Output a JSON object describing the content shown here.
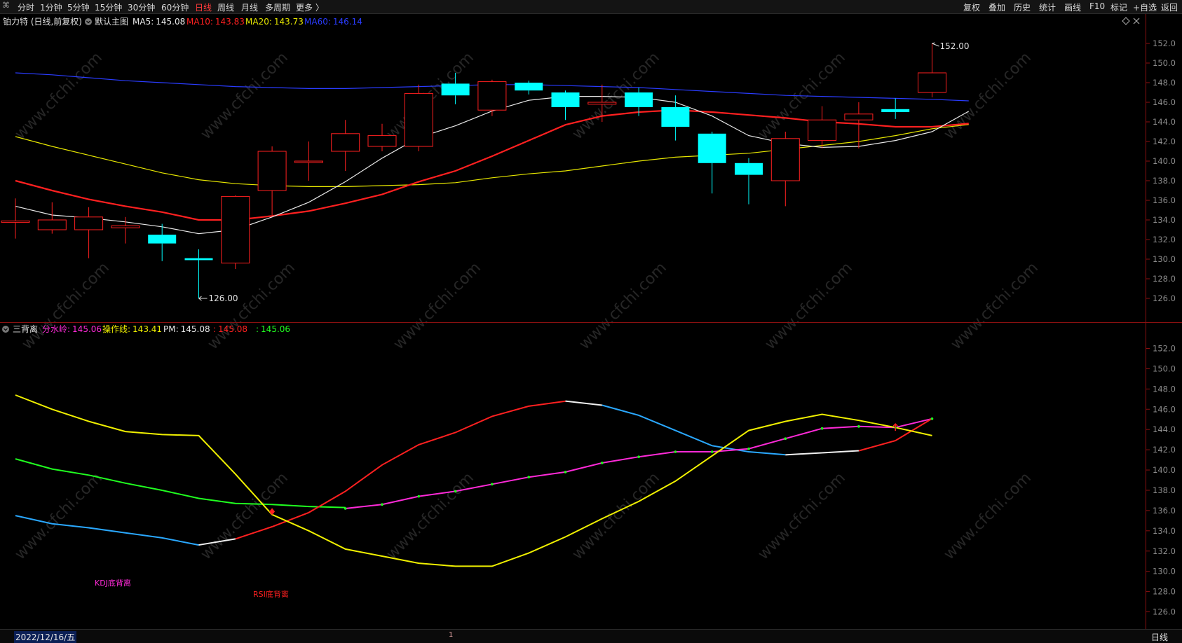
{
  "toolbar": {
    "logo_glyph": "⌘",
    "periods": [
      "分时",
      "1分钟",
      "5分钟",
      "15分钟",
      "30分钟",
      "60分钟",
      "日线",
      "周线",
      "月线",
      "多周期",
      "更多 〉"
    ],
    "active_period": "日线",
    "right_items": [
      "复权",
      "叠加",
      "历史",
      "统计",
      "画线",
      "F10",
      "标记",
      "+自选",
      "返回"
    ]
  },
  "main_panel": {
    "stock_title": "铂力特 (日线,前复权)",
    "template_label": "默认主图",
    "ma_legend": [
      {
        "label": "MA5:",
        "value": "145.08",
        "color": "#e8e8e8"
      },
      {
        "label": "MA10:",
        "value": "143.83",
        "color": "#ff2020"
      },
      {
        "label": "MA20:",
        "value": "143.73",
        "color": "#e6e600"
      },
      {
        "label": "MA60:",
        "value": "146.14",
        "color": "#2a3cff"
      }
    ],
    "high_label": "152.00",
    "low_label": "126.00",
    "corner_icons": [
      "diamond-icon",
      "close-icon"
    ]
  },
  "indicator_panel": {
    "name": "三背离",
    "legend": [
      {
        "label": "分水岭:",
        "value": "145.06",
        "color": "#ff2ad8"
      },
      {
        "label": "操作线:",
        "value": "143.41",
        "color": "#f0f000"
      },
      {
        "label": "PM:",
        "value": "145.08",
        "color": "#e8e8e8"
      },
      {
        "label": ":",
        "value": "145.08",
        "color": "#ff2020"
      },
      {
        "label": ":",
        "value": "145.06",
        "color": "#20ff20"
      }
    ],
    "annotations": [
      {
        "text": "KDJ底背离",
        "color": "#ff2ad8"
      },
      {
        "text": "RSI底背离",
        "color": "#ff2020"
      }
    ]
  },
  "footer": {
    "date": "2022/12/16/五",
    "page_indicator": "1",
    "period": "日线"
  },
  "watermark": "www.cfchi.com",
  "chart_data": [
    {
      "type": "candlestick",
      "title": "铂力特 (日线,前复权)",
      "ylim": [
        125,
        153
      ],
      "y_ticks": [
        "152.0",
        "150.0",
        "148.0",
        "146.0",
        "144.0",
        "142.0",
        "140.0",
        "138.0",
        "136.0",
        "134.0",
        "132.0",
        "130.0",
        "128.0",
        "126.0"
      ],
      "colors": {
        "up": "#ff2020",
        "down": "#00ffff",
        "ma5": "#e8e8e8",
        "ma10": "#ff2020",
        "ma20": "#e6e600",
        "ma60": "#2a3cff"
      },
      "candles": [
        {
          "o": 133.9,
          "h": 136.2,
          "l": 132.1,
          "c": 133.9
        },
        {
          "o": 133.0,
          "h": 135.8,
          "l": 132.6,
          "c": 134.0
        },
        {
          "o": 133.0,
          "h": 135.3,
          "l": 130.1,
          "c": 134.3
        },
        {
          "o": 133.2,
          "h": 134.3,
          "l": 131.6,
          "c": 133.4
        },
        {
          "o": 132.5,
          "h": 133.6,
          "l": 129.8,
          "c": 131.6
        },
        {
          "o": 130.1,
          "h": 131.0,
          "l": 126.0,
          "c": 129.9
        },
        {
          "o": 129.6,
          "h": 136.5,
          "l": 129.0,
          "c": 136.4
        },
        {
          "o": 137.0,
          "h": 141.5,
          "l": 134.5,
          "c": 141.0
        },
        {
          "o": 140.0,
          "h": 142.0,
          "l": 138.0,
          "c": 140.0
        },
        {
          "o": 141.0,
          "h": 144.2,
          "l": 139.0,
          "c": 142.8
        },
        {
          "o": 141.5,
          "h": 143.8,
          "l": 141.0,
          "c": 142.6
        },
        {
          "o": 141.5,
          "h": 147.8,
          "l": 141.0,
          "c": 146.9
        },
        {
          "o": 147.9,
          "h": 149.0,
          "l": 145.8,
          "c": 146.7
        },
        {
          "o": 145.2,
          "h": 148.3,
          "l": 144.6,
          "c": 148.1
        },
        {
          "o": 148.0,
          "h": 148.2,
          "l": 146.8,
          "c": 147.2
        },
        {
          "o": 147.0,
          "h": 147.2,
          "l": 144.2,
          "c": 145.5
        },
        {
          "o": 145.8,
          "h": 147.8,
          "l": 144.0,
          "c": 146.0
        },
        {
          "o": 147.0,
          "h": 147.5,
          "l": 144.6,
          "c": 145.5
        },
        {
          "o": 145.5,
          "h": 146.7,
          "l": 142.1,
          "c": 143.5
        },
        {
          "o": 142.8,
          "h": 143.0,
          "l": 136.7,
          "c": 139.8
        },
        {
          "o": 139.8,
          "h": 140.3,
          "l": 135.6,
          "c": 138.6
        },
        {
          "o": 138.0,
          "h": 143.0,
          "l": 135.4,
          "c": 142.3
        },
        {
          "o": 142.1,
          "h": 145.6,
          "l": 141.3,
          "c": 144.2
        },
        {
          "o": 144.2,
          "h": 146.0,
          "l": 141.3,
          "c": 144.8
        },
        {
          "o": 145.3,
          "h": 146.4,
          "l": 144.3,
          "c": 145.0
        },
        {
          "o": 147.0,
          "h": 152.0,
          "l": 146.5,
          "c": 149.0
        }
      ],
      "ma5": [
        135.4,
        134.5,
        134.2,
        133.8,
        133.3,
        132.6,
        133.0,
        134.3,
        135.8,
        137.9,
        140.3,
        142.4,
        143.6,
        145.1,
        146.2,
        146.6,
        146.6,
        146.5,
        146.0,
        144.6,
        142.6,
        141.8,
        141.4,
        141.5,
        142.1,
        143.0,
        145.08
      ],
      "ma10": [
        138.0,
        137.0,
        136.1,
        135.4,
        134.8,
        134.0,
        134.0,
        134.4,
        134.9,
        135.7,
        136.6,
        137.9,
        139.0,
        140.5,
        142.1,
        143.7,
        144.6,
        145.0,
        145.2,
        145.0,
        144.7,
        144.4,
        144.0,
        143.8,
        143.5,
        143.5,
        143.83
      ],
      "ma20": [
        142.5,
        141.5,
        140.6,
        139.7,
        138.8,
        138.1,
        137.7,
        137.5,
        137.4,
        137.4,
        137.5,
        137.6,
        137.8,
        138.3,
        138.7,
        139.0,
        139.5,
        140.0,
        140.4,
        140.6,
        140.8,
        141.2,
        141.6,
        142.0,
        142.6,
        143.3,
        143.73
      ],
      "ma60": [
        149.0,
        148.8,
        148.5,
        148.2,
        148.0,
        147.8,
        147.6,
        147.5,
        147.4,
        147.4,
        147.5,
        147.6,
        147.7,
        147.8,
        147.8,
        147.7,
        147.6,
        147.5,
        147.3,
        147.1,
        146.9,
        146.7,
        146.6,
        146.5,
        146.4,
        146.3,
        146.14
      ]
    },
    {
      "type": "line",
      "title": "三背离",
      "ylim": [
        125,
        153
      ],
      "y_ticks": [
        "152.0",
        "150.0",
        "148.0",
        "146.0",
        "144.0",
        "142.0",
        "140.0",
        "138.0",
        "136.0",
        "134.0",
        "132.0",
        "130.0",
        "128.0",
        "126.0"
      ],
      "series": [
        {
          "name": "操作线",
          "color": "#f0f000",
          "values": [
            147.4,
            146.0,
            144.8,
            143.8,
            143.5,
            143.4,
            139.6,
            135.6,
            134.0,
            132.2,
            131.5,
            130.8,
            130.5,
            130.5,
            131.8,
            133.4,
            135.2,
            136.9,
            138.9,
            141.4,
            143.9,
            144.8,
            145.5,
            144.9,
            144.2,
            143.4
          ]
        },
        {
          "name": "分水岭",
          "color": "#ff2ad8",
          "values": [
            null,
            null,
            null,
            null,
            null,
            null,
            null,
            null,
            null,
            136.2,
            136.6,
            137.4,
            137.9,
            138.6,
            139.3,
            139.8,
            140.7,
            141.3,
            141.8,
            141.8,
            142.1,
            143.1,
            144.1,
            144.3,
            144.2,
            145.06
          ]
        },
        {
          "name": "RSI",
          "color": "#ff2020",
          "values": [
            null,
            null,
            null,
            null,
            null,
            null,
            133.2,
            134.4,
            135.8,
            137.9,
            140.5,
            142.5,
            143.7,
            145.3,
            146.3,
            146.8,
            null,
            null,
            null,
            null,
            null,
            null,
            null,
            141.9,
            142.9,
            145.08
          ]
        },
        {
          "name": "KDJ",
          "color": "#2aa8ff",
          "values": [
            135.5,
            134.7,
            134.3,
            133.8,
            133.3,
            132.6,
            null,
            null,
            null,
            null,
            null,
            null,
            null,
            null,
            null,
            null,
            146.4,
            145.4,
            143.9,
            142.4,
            141.8,
            141.5,
            null,
            null,
            null,
            null
          ]
        },
        {
          "name": "green",
          "color": "#20ff20",
          "values": [
            141.1,
            140.1,
            139.5,
            138.7,
            138.0,
            137.2,
            136.7,
            136.6,
            136.4,
            136.3,
            null,
            null,
            null,
            null,
            null,
            null,
            null,
            null,
            null,
            141.8,
            null,
            null,
            null,
            null,
            null,
            145.06
          ]
        }
      ]
    }
  ]
}
